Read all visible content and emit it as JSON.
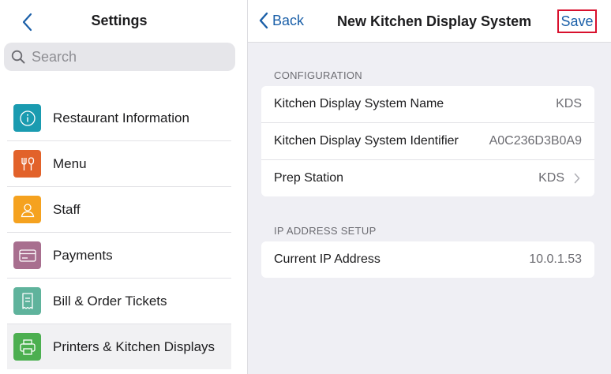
{
  "sidebar": {
    "title": "Settings",
    "search": {
      "placeholder": "Search",
      "value": ""
    },
    "items": [
      {
        "label": "Restaurant Information",
        "icon": "info-icon",
        "color": "#1a9bb0"
      },
      {
        "label": "Menu",
        "icon": "utensils-icon",
        "color": "#e2622a"
      },
      {
        "label": "Staff",
        "icon": "person-icon",
        "color": "#f5a21f"
      },
      {
        "label": "Payments",
        "icon": "card-icon",
        "color": "#a86f8f"
      },
      {
        "label": "Bill & Order Tickets",
        "icon": "receipt-icon",
        "color": "#5fb39c"
      },
      {
        "label": "Printers & Kitchen Displays",
        "icon": "printer-icon",
        "color": "#4caf50",
        "selected": true
      }
    ]
  },
  "nav": {
    "back_label": "Back",
    "title": "New Kitchen Display System",
    "save_label": "Save"
  },
  "configuration": {
    "header": "CONFIGURATION",
    "rows": [
      {
        "label": "Kitchen Display System Name",
        "value": "KDS"
      },
      {
        "label": "Kitchen Display System Identifier",
        "value": "A0C236D3B0A9"
      },
      {
        "label": "Prep Station",
        "value": "KDS"
      }
    ]
  },
  "ip_setup": {
    "header": "IP ADDRESS SETUP",
    "rows": [
      {
        "label": "Current IP Address",
        "value": "10.0.1.53"
      }
    ]
  },
  "colors": {
    "accent": "#1a5fa8",
    "save_highlight": "#d8102d"
  }
}
